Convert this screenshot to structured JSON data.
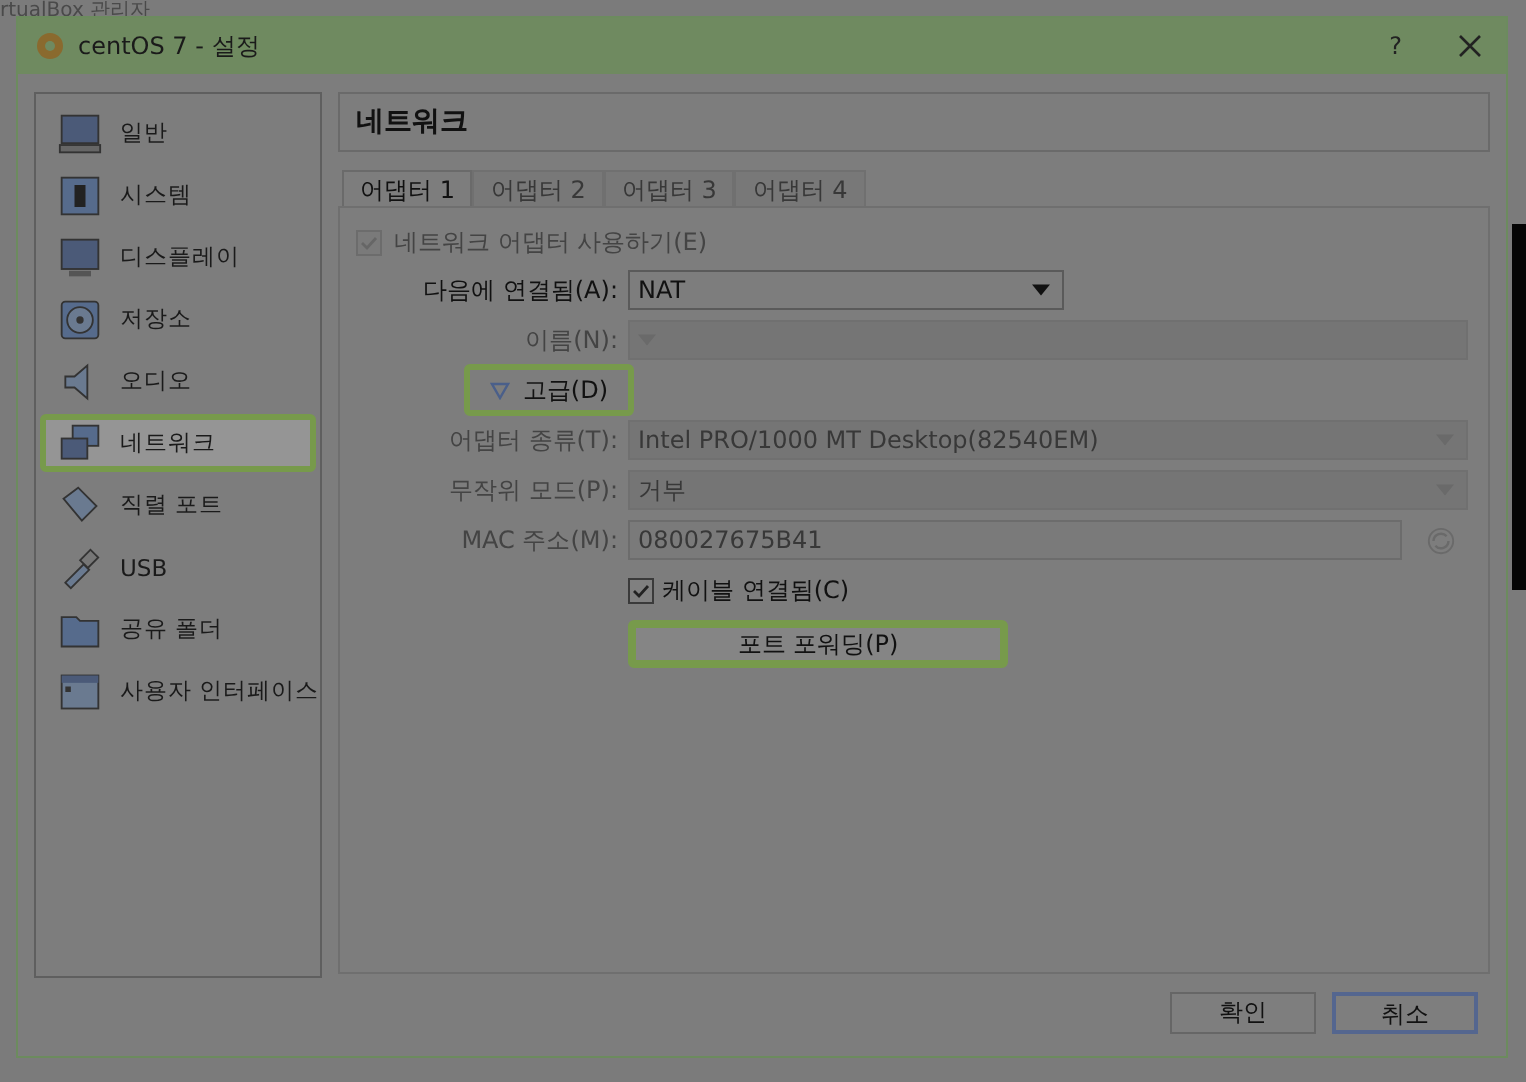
{
  "background": {
    "title": "rtualBox 관리자"
  },
  "window": {
    "title": "centOS 7 - 설정",
    "help": "?"
  },
  "sidebar": {
    "items": [
      {
        "kind": "general",
        "label": "일반",
        "selected": false,
        "highlighted": false
      },
      {
        "kind": "system",
        "label": "시스템",
        "selected": false,
        "highlighted": false
      },
      {
        "kind": "display",
        "label": "디스플레이",
        "selected": false,
        "highlighted": false
      },
      {
        "kind": "storage",
        "label": "저장소",
        "selected": false,
        "highlighted": false
      },
      {
        "kind": "audio",
        "label": "오디오",
        "selected": false,
        "highlighted": false
      },
      {
        "kind": "network",
        "label": "네트워크",
        "selected": true,
        "highlighted": true
      },
      {
        "kind": "serial",
        "label": "직렬 포트",
        "selected": false,
        "highlighted": false
      },
      {
        "kind": "usb",
        "label": "USB",
        "selected": false,
        "highlighted": false
      },
      {
        "kind": "folder",
        "label": "공유 폴더",
        "selected": false,
        "highlighted": false
      },
      {
        "kind": "ui",
        "label": "사용자 인터페이스",
        "selected": false,
        "highlighted": false
      }
    ]
  },
  "page_title": "네트워크",
  "tabs": [
    {
      "label": "어댑터 1",
      "selected": true
    },
    {
      "label": "어댑터 2",
      "selected": false
    },
    {
      "label": "어댑터 3",
      "selected": false
    },
    {
      "label": "어댑터 4",
      "selected": false
    }
  ],
  "form": {
    "enable": {
      "label": "네트워크 어댑터 사용하기(E)",
      "checked": true,
      "disabled": true
    },
    "rows": [
      {
        "kind": "combo",
        "label": "다음에 연결됨(A):",
        "value": "NAT",
        "disabled": false
      },
      {
        "kind": "combo",
        "label": "이름(N):",
        "disabled": true
      },
      {
        "kind": "expander",
        "label": "고급(D)",
        "expanded": true,
        "highlighted": true
      },
      {
        "kind": "combo",
        "label": "어댑터 종류(T):",
        "value": "Intel PRO/1000 MT Desktop(82540EM)",
        "disabled": true
      },
      {
        "kind": "combo",
        "label": "무작위 모드(P):",
        "value": "거부",
        "disabled": true
      },
      {
        "kind": "text",
        "label": "MAC 주소(M):",
        "value": "080027675B41",
        "disabled": true
      },
      {
        "kind": "checkbox",
        "label": "케이블 연결됨(C)",
        "checked": true,
        "disabled": false
      },
      {
        "kind": "button",
        "label": "포트 포워딩(P)",
        "highlighted": true
      }
    ]
  },
  "buttons": [
    {
      "label": "확인",
      "focused": false
    },
    {
      "label": "취소",
      "focused": true
    }
  ]
}
